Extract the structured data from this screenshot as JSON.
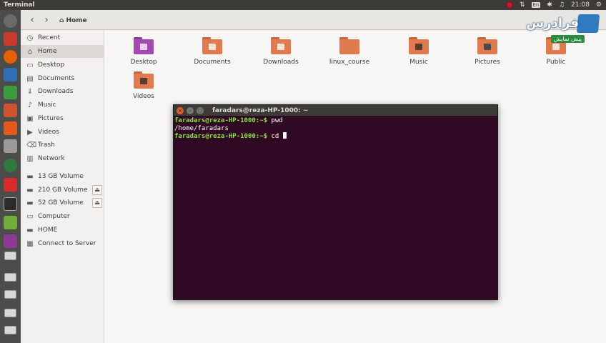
{
  "top_panel": {
    "title": "Terminal",
    "clock": "21:08",
    "keyboard_layout": "En"
  },
  "nav": {
    "back_glyph": "‹",
    "forward_glyph": "›",
    "location_icon": "home-icon",
    "location_label": "Home"
  },
  "sidebar": {
    "items": [
      {
        "label": "Recent",
        "icon": "clock-icon",
        "glyph": "◷"
      },
      {
        "label": "Home",
        "icon": "home-icon",
        "glyph": "⌂"
      },
      {
        "label": "Desktop",
        "icon": "desktop-icon",
        "glyph": "▭"
      },
      {
        "label": "Documents",
        "icon": "document-icon",
        "glyph": "▤"
      },
      {
        "label": "Downloads",
        "icon": "download-icon",
        "glyph": "⇓"
      },
      {
        "label": "Music",
        "icon": "music-icon",
        "glyph": "♪"
      },
      {
        "label": "Pictures",
        "icon": "picture-icon",
        "glyph": "▣"
      },
      {
        "label": "Videos",
        "icon": "video-icon",
        "glyph": "▶"
      },
      {
        "label": "Trash",
        "icon": "trash-icon",
        "glyph": "⌫"
      },
      {
        "label": "Network",
        "icon": "network-icon",
        "glyph": "▥"
      },
      {
        "label": "13 GB Volume",
        "icon": "drive-icon",
        "glyph": "▬"
      },
      {
        "label": "210 GB Volume",
        "icon": "drive-icon",
        "glyph": "▬"
      },
      {
        "label": "52 GB Volume",
        "icon": "drive-icon",
        "glyph": "▬"
      },
      {
        "label": "Computer",
        "icon": "computer-icon",
        "glyph": "▭"
      },
      {
        "label": "HOME",
        "icon": "drive-icon",
        "glyph": "▬"
      },
      {
        "label": "Connect to Server",
        "icon": "server-icon",
        "glyph": "▦"
      }
    ],
    "eject_glyph": "⏏"
  },
  "files": [
    {
      "label": "Desktop",
      "color": "#a24ab1",
      "emblem": "desktop"
    },
    {
      "label": "Documents",
      "color": "#e07b4f",
      "emblem": "documents"
    },
    {
      "label": "Downloads",
      "color": "#e07b4f",
      "emblem": "downloads"
    },
    {
      "label": "linux_course",
      "color": "#e07b4f",
      "emblem": ""
    },
    {
      "label": "Music",
      "color": "#e07b4f",
      "emblem": "music"
    },
    {
      "label": "Pictures",
      "color": "#e07b4f",
      "emblem": "pictures"
    },
    {
      "label": "Public",
      "color": "#e07b4f",
      "emblem": "public"
    },
    {
      "label": "Videos",
      "color": "#e07b4f",
      "emblem": "videos"
    }
  ],
  "terminal": {
    "title": "faradars@reza-HP-1000: ~",
    "close_glyph": "×",
    "min_glyph": "–",
    "max_glyph": "□",
    "lines": [
      {
        "prompt": "faradars@reza-HP-1000:~$",
        "text": " pwd"
      },
      {
        "prompt": "",
        "text": "/home/faradars"
      },
      {
        "prompt": "faradars@reza-HP-1000:~$",
        "text": " cd "
      }
    ]
  },
  "watermark": {
    "brand": "فرادرس",
    "banner": "پیش نمایش"
  },
  "colors": {
    "terminal_bg": "#300a24",
    "prompt_green": "#8ae234",
    "panel_dark": "#3c3b37",
    "launcher": "#4c4c4a"
  }
}
